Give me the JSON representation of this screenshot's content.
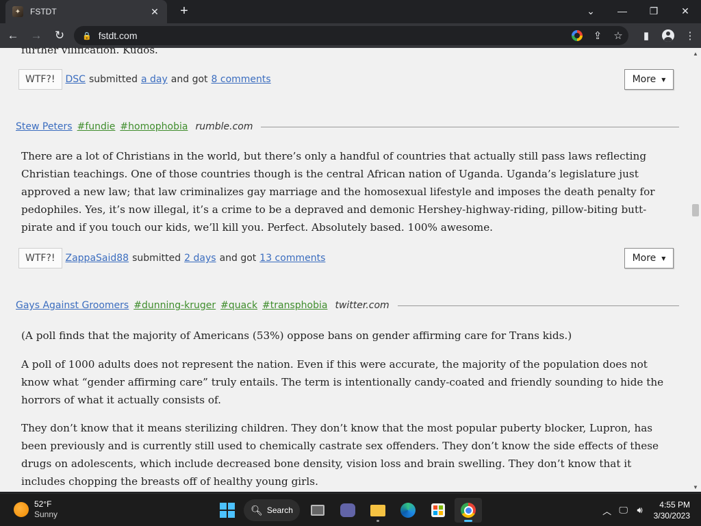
{
  "browser": {
    "tab_title": "FSTDT",
    "tab_close": "✕",
    "new_tab": "+",
    "url": "fstdt.com",
    "window": {
      "minimize": "—",
      "restore": "❐",
      "close": "✕",
      "tab_search": "⌄"
    }
  },
  "page": {
    "cut_text": "further vilification. Kudos.",
    "posts": [
      {
        "footer": {
          "wtf": "WTF?!",
          "user": "DSC",
          "submitted": "submitted",
          "when": "a day",
          "and_got": "and got",
          "comments": "8 comments",
          "more": "More"
        }
      },
      {
        "author": "Stew Peters",
        "tags": [
          "#fundie",
          "#homophobia"
        ],
        "source": "rumble.com",
        "paragraphs": [
          "There are a lot of Christians in the world, but there’s only a handful of countries that actually still pass laws reflecting Christian teachings. One of those countries though is the central African nation of Uganda. Uganda’s legislature just approved a new law; that law criminalizes gay marriage and the homosexual lifestyle and imposes the death penalty for pedophiles. Yes, it’s now illegal, it’s a crime to be a depraved and demonic Hershey-highway-riding, pillow-biting butt-pirate and if you touch our kids, we’ll kill you. Perfect. Absolutely based. 100% awesome."
        ],
        "footer": {
          "wtf": "WTF?!",
          "user": "ZappaSaid88",
          "submitted": "submitted",
          "when": "2 days",
          "and_got": "and got",
          "comments": "13 comments",
          "more": "More"
        }
      },
      {
        "author": "Gays Against Groomers",
        "tags": [
          "#dunning-kruger",
          "#quack",
          "#transphobia"
        ],
        "source": "twitter.com",
        "paragraphs": [
          "(A poll finds that the majority of Americans (53%) oppose bans on gender affirming care for Trans kids.)",
          "A poll of 1000 adults does not represent the nation. Even if this were accurate, the majority of the population does not know what “gender affirming care” truly entails. The term is intentionally candy-coated and friendly sounding to hide the horrors of what it actually consists of.",
          "They don’t know that it means sterilizing children. They don’t know that the most popular puberty blocker, Lupron, has been previously and is currently still used to chemically castrate sex offenders. They don’t know the side effects of these drugs on adolescents, which include decreased bone density, vision loss and brain swelling. They don’t know that it includes chopping the breasts off of healthy young girls."
        ]
      }
    ]
  },
  "taskbar": {
    "weather": {
      "temp": "52°F",
      "condition": "Sunny"
    },
    "search_label": "Search",
    "time": "4:55 PM",
    "date": "3/30/2023"
  },
  "colors": {
    "link": "#3b6dbf",
    "tag": "#3f8d2c",
    "page_bg": "#f1f1f1"
  }
}
